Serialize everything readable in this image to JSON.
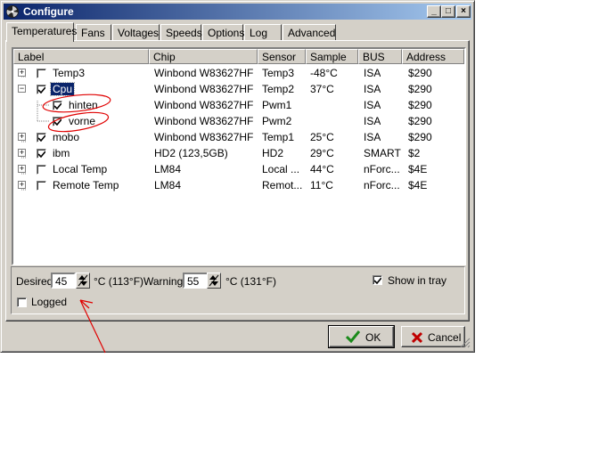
{
  "window": {
    "title": "Configure"
  },
  "tabs": [
    {
      "label": "Temperatures"
    },
    {
      "label": "Fans"
    },
    {
      "label": "Voltages"
    },
    {
      "label": "Speeds"
    },
    {
      "label": "Options"
    },
    {
      "label": "Log"
    },
    {
      "label": "Advanced"
    }
  ],
  "columns": [
    "Label",
    "Chip",
    "Sensor",
    "Sample",
    "BUS",
    "Address"
  ],
  "rows": [
    {
      "label": "Temp3",
      "chip": "Winbond W83627HF",
      "sensor": "Temp3",
      "sample": "-48°C",
      "bus": "ISA",
      "address": "$290",
      "checked": false,
      "expander": "+"
    },
    {
      "label": "Cpu",
      "chip": "Winbond W83627HF",
      "sensor": "Temp2",
      "sample": "37°C",
      "bus": "ISA",
      "address": "$290",
      "checked": true,
      "expander": "−"
    },
    {
      "label": "hinten",
      "chip": "Winbond W83627HF",
      "sensor": "Pwm1",
      "sample": "",
      "bus": "ISA",
      "address": "$290",
      "checked": true,
      "expander": ""
    },
    {
      "label": "vorne",
      "chip": "Winbond W83627HF",
      "sensor": "Pwm2",
      "sample": "",
      "bus": "ISA",
      "address": "$290",
      "checked": true,
      "expander": ""
    },
    {
      "label": "mobo",
      "chip": "Winbond W83627HF",
      "sensor": "Temp1",
      "sample": "25°C",
      "bus": "ISA",
      "address": "$290",
      "checked": true,
      "expander": "+"
    },
    {
      "label": "ibm",
      "chip": "HD2 (123,5GB)",
      "sensor": "HD2",
      "sample": "29°C",
      "bus": "SMART",
      "address": "$2",
      "checked": true,
      "expander": "+"
    },
    {
      "label": "Local Temp",
      "chip": "LM84",
      "sensor": "Local ...",
      "sample": "44°C",
      "bus": "nForc...",
      "address": "$4E",
      "checked": false,
      "expander": "+"
    },
    {
      "label": "Remote Temp",
      "chip": "LM84",
      "sensor": "Remot...",
      "sample": "11°C",
      "bus": "nForc...",
      "address": "$4E",
      "checked": false,
      "expander": "+"
    }
  ],
  "settings": {
    "desired_label": "Desired",
    "desired_value": "45",
    "desired_unit": "°C (113°F)",
    "warning_label": "Warning",
    "warning_value": "55",
    "warning_unit": "°C (131°F)",
    "show_in_tray_label": "Show in tray",
    "show_in_tray": true,
    "logged_label": "Logged",
    "logged": false
  },
  "buttons": {
    "ok": "OK",
    "cancel": "Cancel"
  },
  "colors": {
    "title_start": "#0a246a",
    "title_end": "#a6caf0",
    "selection": "#0a246a",
    "annotation": "#e00000"
  }
}
